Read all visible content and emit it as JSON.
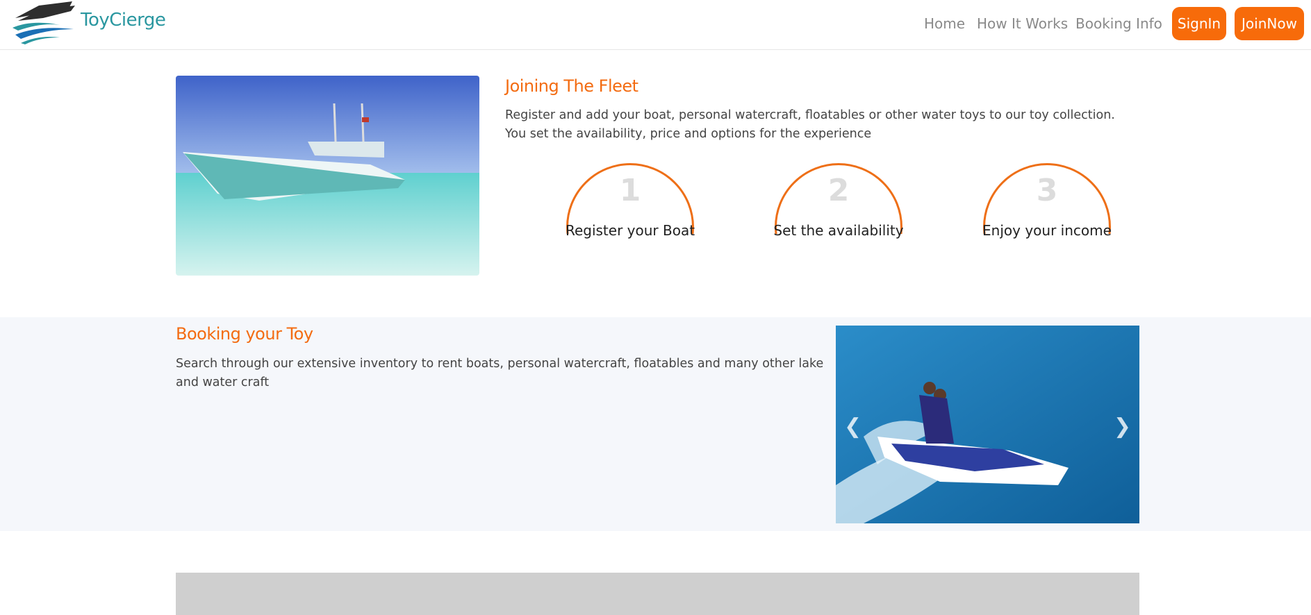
{
  "brand": {
    "name": "ToyCierge"
  },
  "nav": {
    "links": [
      "Home",
      "How It Works",
      "Booking Info"
    ],
    "signin": "SignIn",
    "joinnow": "JoinNow"
  },
  "fleet": {
    "title": "Joining The Fleet",
    "description": "Register and add your boat, personal watercraft, floatables or other water toys to our toy collection. You set the availability, price and options for the experience",
    "steps": [
      {
        "number": "1",
        "label": "Register your Boat"
      },
      {
        "number": "2",
        "label": "Set the availability"
      },
      {
        "number": "3",
        "label": "Enjoy your income"
      }
    ]
  },
  "booking": {
    "title": "Booking your Toy",
    "description": "Search through our extensive inventory to rent boats, personal watercraft, floatables and many other lake and water craft"
  },
  "carousel": {
    "prev_icon": "chevron-left-icon",
    "next_icon": "chevron-right-icon"
  },
  "colors": {
    "accent": "#f76b0a",
    "brand": "#2a97a0",
    "band": "#f5f7fb"
  }
}
